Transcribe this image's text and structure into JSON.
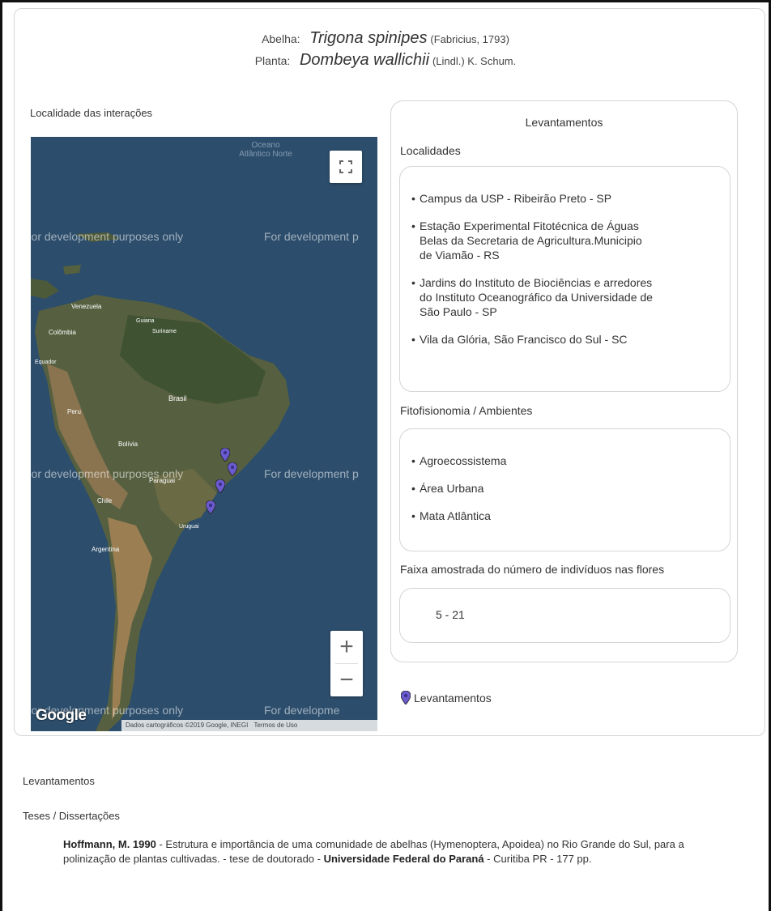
{
  "header": {
    "bee_label": "Abelha:",
    "bee_name": "Trigona spinipes",
    "bee_author": "(Fabricius, 1793)",
    "plant_label": "Planta:",
    "plant_name": "Dombeya wallichii",
    "plant_author": "(Lindl.) K. Schum."
  },
  "map": {
    "title": "Localidade das interações",
    "dev_text": "For development purposes only",
    "dev_text_cut": "For development p",
    "dev_text_cut2": "For developme",
    "ocean_label": "Oceano Atlântico Norte",
    "countries": [
      "Venezuela",
      "Colômbia",
      "Guiana",
      "Suriname",
      "Equador",
      "Brasil",
      "Peru",
      "Bolívia",
      "Paraguai",
      "Chile",
      "Uruguai",
      "Argentina"
    ],
    "zoom_in": "+",
    "zoom_out": "−",
    "google": "Google",
    "attribution": "Dados cartográficos ©2019 Google, INEGI",
    "terms": "Termos de Uso",
    "marker_count": 4,
    "water_color": "#2a4a66",
    "land_color": "#4d5a3a",
    "marker_color": "#6a5acd"
  },
  "surveys": {
    "title": "Levantamentos",
    "localities_label": "Localidades",
    "localities": [
      "Campus da USP - Ribeirão Preto - SP",
      "Estação Experimental Fitotécnica de Águas Belas da Secretaria de Agricultura.Municipio de Viamão - RS",
      "Jardins do Instituto de Biociências e arredores do Instituto Oceanográfico da Universidade de São Paulo - SP",
      "Vila da Glória, São Francisco do Sul - SC"
    ],
    "phyto_label": "Fitofisionomia / Ambientes",
    "phyto": [
      "Agroecossistema",
      "Área Urbana",
      "Mata Atlântica"
    ],
    "range_label": "Faixa amostrada do número de indivíduos nas flores",
    "range_value": "5 - 21"
  },
  "legend": {
    "label": "Levantamentos"
  },
  "bottom": {
    "section_label": "Levantamentos",
    "theses_label": "Teses / Dissertações",
    "ref1_author": "Hoffmann, M. 1990",
    "ref1_title": " - Estrutura e importância de uma comunidade de abelhas (Hymenoptera, Apoidea) no Rio Grande do Sul, para a polinização de plantas cultivadas. - tese de doutorado - ",
    "ref1_inst": "Universidade Federal do Paraná",
    "ref1_tail": " - Curitiba PR - 177 pp."
  }
}
